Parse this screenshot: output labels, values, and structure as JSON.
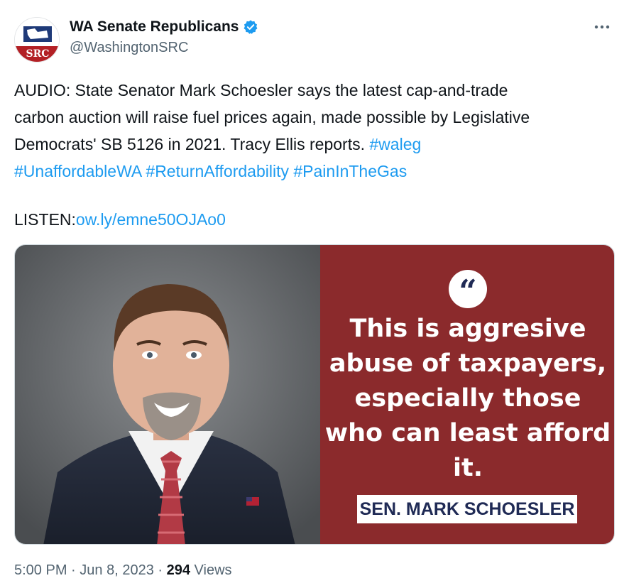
{
  "account": {
    "display_name": "WA Senate Republicans",
    "handle": "@WashingtonSRC",
    "avatar_text": "SRC",
    "verified": true
  },
  "tweet": {
    "lines": [
      "AUDIO: State Senator Mark Schoesler says the latest cap-and-trade",
      "carbon auction will raise fuel prices again, made possible by Legislative",
      "Democrats' SB 5126 in 2021. Tracy Ellis reports."
    ],
    "hashtags": [
      "#waleg",
      "#UnaffordableWA",
      "#ReturnAffordability",
      "#PainInTheGas"
    ],
    "listen_label": "LISTEN:",
    "listen_link": "ow.ly/emne50OJAo0"
  },
  "media": {
    "quote": "This is aggresive\nabuse of taxpayers,\nespecially those\nwho can least afford\nit.",
    "attribution": "SEN. MARK SCHOESLER"
  },
  "meta": {
    "time": "5:00 PM",
    "date": "Jun 8, 2023",
    "views_count": "294",
    "views_label": "Views",
    "separator": "·"
  },
  "colors": {
    "link": "#1d9bf0",
    "quote_panel": "#8b2a2c",
    "attribution_text": "#1f2a55",
    "secondary_text": "#536471"
  }
}
